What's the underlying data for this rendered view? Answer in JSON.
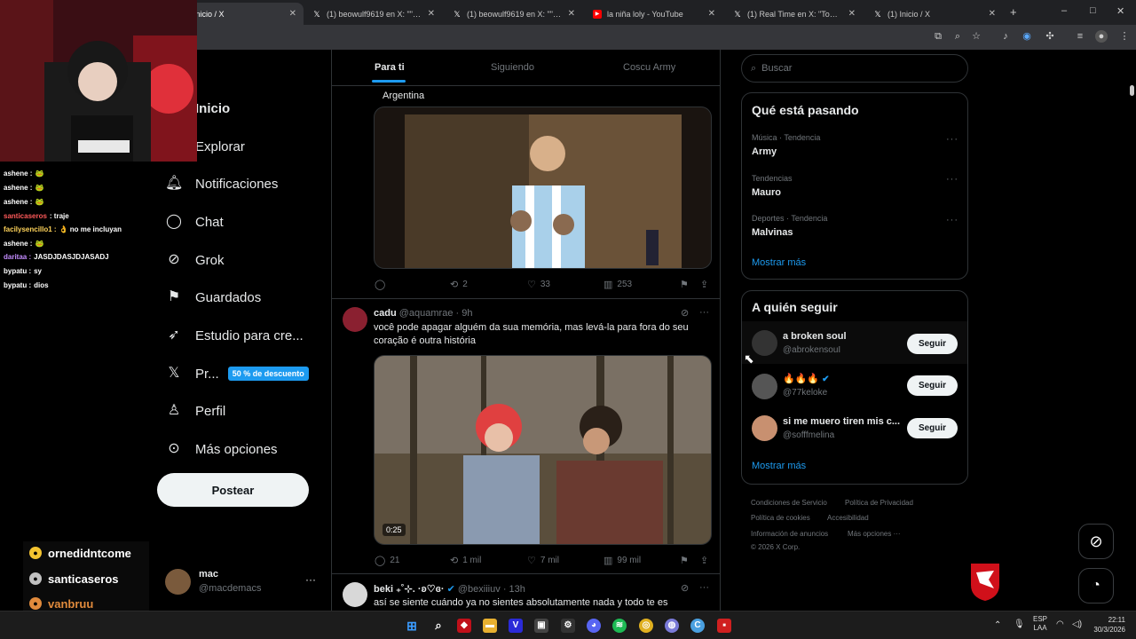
{
  "browser": {
    "tabs": [
      {
        "title": "Inicio / X",
        "icon": "x-logo",
        "active": true
      },
      {
        "title": "(1) beowulf9619 en X: \"\"Lolo c",
        "icon": "x-logo"
      },
      {
        "title": "(1) beowulf9619 en X: \"\"Lolo c",
        "icon": "x-logo"
      },
      {
        "title": "la niña loly - YouTube",
        "icon": "youtube-logo"
      },
      {
        "title": "(1) Real Time en X: \"Tomas Der",
        "icon": "x-logo"
      },
      {
        "title": "(1) Inicio / X",
        "icon": "x-logo"
      }
    ],
    "new_tab": "+",
    "window_controls": {
      "minimize": "–",
      "maximize": "□",
      "close": "✕"
    }
  },
  "sidebar": {
    "items": [
      {
        "label": "Inicio",
        "icon": "home-icon"
      },
      {
        "label": "Explorar",
        "icon": "search-icon"
      },
      {
        "label": "Notificaciones",
        "icon": "bell-icon"
      },
      {
        "label": "Chat",
        "icon": "chat-icon"
      },
      {
        "label": "Grok",
        "icon": "grok-icon"
      },
      {
        "label": "Guardados",
        "icon": "bookmark-icon"
      },
      {
        "label": "Estudio para cre...",
        "icon": "rocket-icon"
      },
      {
        "label": "Pr...",
        "icon": "x-logo-icon",
        "badge": "50 % de descuento"
      },
      {
        "label": "Perfil",
        "icon": "person-icon"
      },
      {
        "label": "Más opciones",
        "icon": "more-circle-icon"
      }
    ],
    "post_button": "Postear",
    "account": {
      "name": "mac",
      "handle": "@macdemacs",
      "more": "···"
    }
  },
  "feed": {
    "tabs": [
      "Para ti",
      "Siguiendo",
      "Coscu Army"
    ],
    "post1": {
      "text": "Argentina",
      "counts": {
        "replies": "",
        "reposts": "2",
        "likes": "33",
        "views": "253"
      }
    },
    "post2": {
      "name": "cadu",
      "handle": "@aquamrae",
      "time": "· 9h",
      "text": "você pode apagar alguém da sua memória, mas levá-la para fora do seu coração é outra história",
      "video_time": "0:25",
      "counts": {
        "replies": "21",
        "reposts": "1 mil",
        "likes": "7 mil",
        "views": "99 mil"
      }
    },
    "post3": {
      "name": "beki ₊˚⊹. ·ʚ♡ɞ·",
      "handle": "@bexiiiuv",
      "time": "· 13h",
      "text": "así se siente cuándo ya no sientes absolutamente nada y todo te es"
    }
  },
  "right": {
    "search_placeholder": "Buscar",
    "trends": {
      "title": "Qué está pasando",
      "items": [
        {
          "category": "Música · Tendencia",
          "name": "Army"
        },
        {
          "category": "Tendencias",
          "name": "Mauro"
        },
        {
          "category": "Deportes · Tendencia",
          "name": "Malvinas"
        }
      ],
      "more": "Mostrar más"
    },
    "who_to_follow": {
      "title": "A quién seguir",
      "items": [
        {
          "name": "a broken soul",
          "handle": "@abrokensouI",
          "button": "Seguir"
        },
        {
          "name": "🔥🔥🔥",
          "handle": "@77keloke",
          "button": "Seguir",
          "verified": true
        },
        {
          "name": "si me muero tiren mis c...",
          "handle": "@sofffmelina",
          "button": "Seguir"
        }
      ],
      "more": "Mostrar más"
    },
    "footer": {
      "links": [
        "Condiciones de Servicio",
        "Política de Privacidad",
        "Política de cookies",
        "Accesibilidad",
        "Información de anuncios",
        "Más opciones ···"
      ],
      "copyright": "© 2026 X Corp."
    }
  },
  "stream_chat": {
    "messages": [
      {
        "user": "ashene :",
        "text": "🐸",
        "color": "#ffffff"
      },
      {
        "user": "ashene :",
        "text": "🐸",
        "color": "#ffffff"
      },
      {
        "user": "ashene :",
        "text": "🐸",
        "color": "#ffffff"
      },
      {
        "user": "santicaseros",
        "text": ": traje",
        "color": "#ff5a5a"
      },
      {
        "user": "facilysencillo1 :",
        "text": "👌 no me incluyan",
        "color": "#ffd35a"
      },
      {
        "user": "ashene :",
        "text": "🐸",
        "color": "#ffffff"
      },
      {
        "user": "daritaa :",
        "text": "JASDJDASJDJASADJ",
        "color": "#c48cff"
      },
      {
        "user": "bypatu :",
        "text": "sy",
        "color": "#ffffff"
      },
      {
        "user": "bypatu :",
        "text": "dios",
        "color": "#ffffff"
      }
    ],
    "supporters": [
      {
        "name": "ornedidntcome",
        "color": "#f4c430"
      },
      {
        "name": "santicaseros",
        "color": "#c0c0c0"
      },
      {
        "name": "vanbruu",
        "color": "#e08a3c"
      }
    ]
  },
  "taskbar": {
    "language": "ESP",
    "region": "LAA",
    "time": "22:11",
    "date": "30/3/2026"
  },
  "colors": {
    "accent": "#1d9bf0",
    "background": "#000000",
    "border": "#2f3336",
    "muted": "#71767b"
  }
}
